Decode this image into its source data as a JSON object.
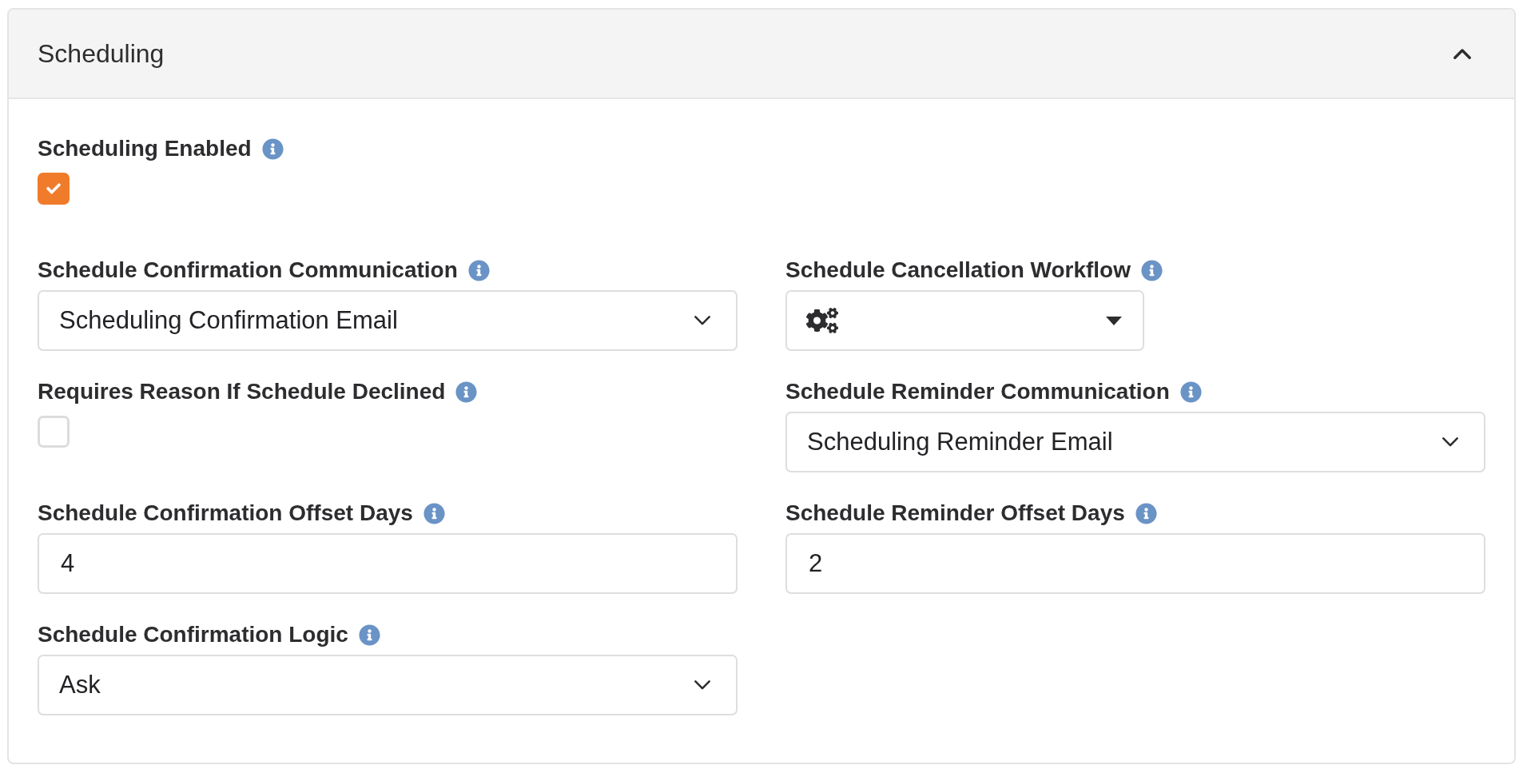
{
  "panel": {
    "title": "Scheduling",
    "expanded": true
  },
  "top_field": {
    "label": "Scheduling Enabled",
    "kind": "checkbox",
    "checked": true
  },
  "fields": [
    {
      "label": "Schedule Confirmation Communication",
      "kind": "select",
      "value": "Scheduling Confirmation Email"
    },
    {
      "label": "Schedule Cancellation Workflow",
      "kind": "workflow_picker"
    },
    {
      "label": "Requires Reason If Schedule Declined",
      "kind": "checkbox",
      "checked": false
    },
    {
      "label": "Schedule Reminder Communication",
      "kind": "select",
      "value": "Scheduling Reminder Email"
    },
    {
      "label": "Schedule Confirmation Offset Days",
      "kind": "text",
      "value": "4"
    },
    {
      "label": "Schedule Reminder Offset Days",
      "kind": "text",
      "value": "2"
    },
    {
      "label": "Schedule Confirmation Logic",
      "kind": "select",
      "value": "Ask"
    }
  ]
}
